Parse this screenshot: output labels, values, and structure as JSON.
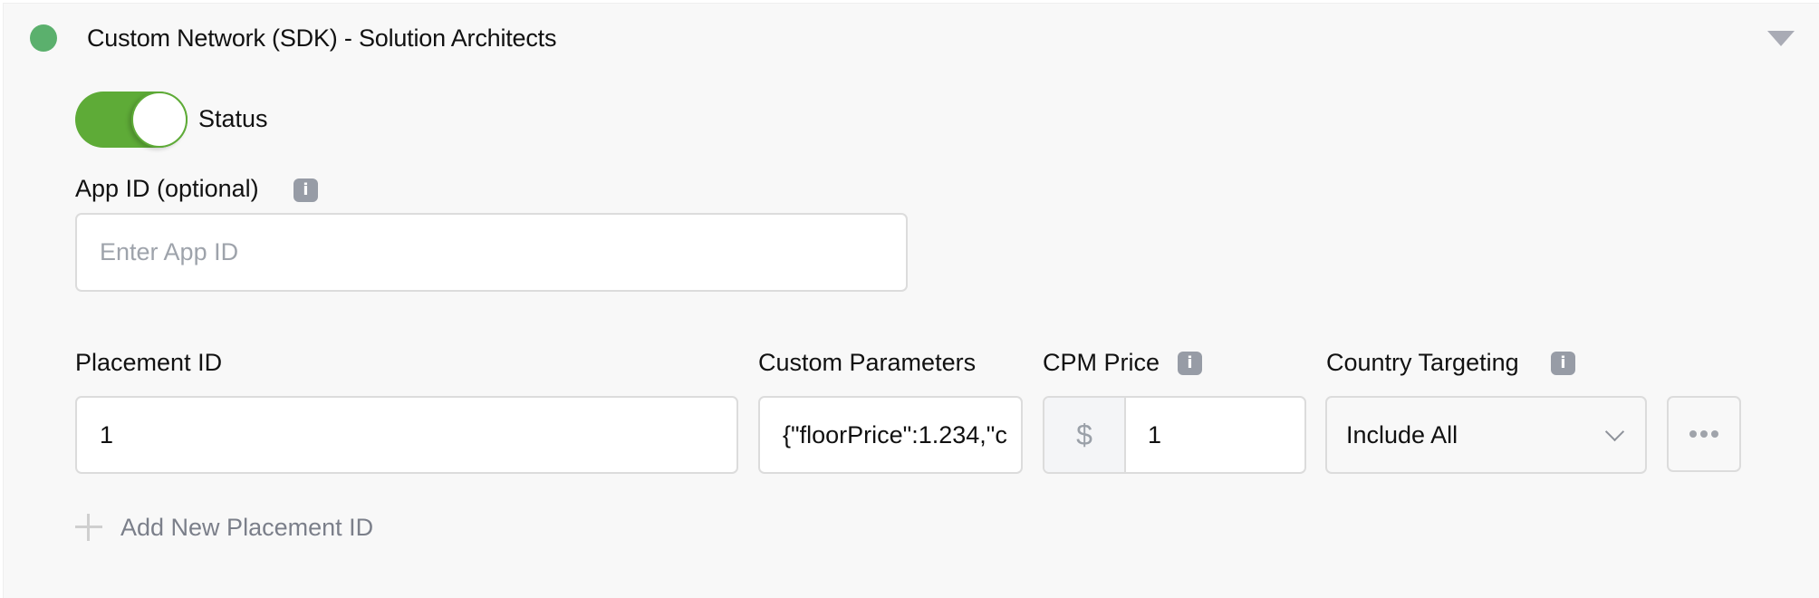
{
  "network": {
    "title": "Custom Network (SDK) - Solution Architects",
    "status_dot_color": "#5bb06d",
    "collapse_icon": "triangle-down-icon"
  },
  "status_toggle": {
    "label": "Status",
    "on": true,
    "color": "#5eab37"
  },
  "app_id": {
    "label": "App ID (optional)",
    "info_icon": "i",
    "value": "",
    "placeholder": "Enter App ID"
  },
  "placement": {
    "columns": {
      "placement_id": "Placement ID",
      "custom_parameters": "Custom Parameters",
      "cpm_price": "CPM Price",
      "country_targeting": "Country Targeting"
    },
    "info_icon": "i",
    "rows": [
      {
        "placement_id": "1",
        "custom_parameters": "{\"floorPrice\":1.234,\"c",
        "cpm_currency": "$",
        "cpm_price": "1",
        "country_targeting": "Include All",
        "more_icon": "ellipsis-icon"
      }
    ],
    "add_label": "Add New Placement ID"
  }
}
